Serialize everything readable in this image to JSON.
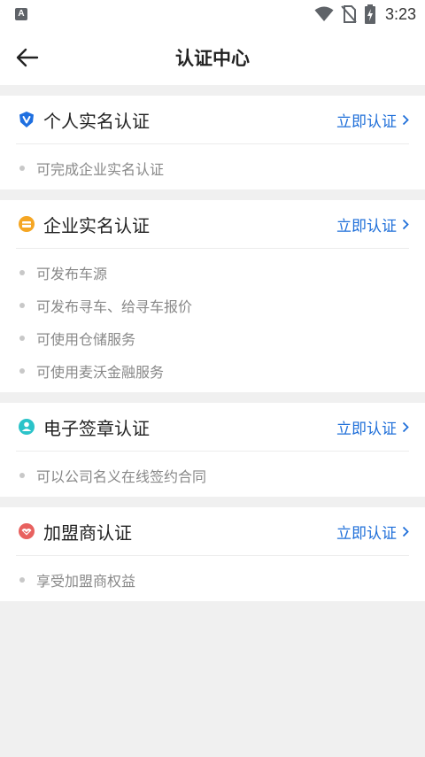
{
  "status_bar": {
    "app_badge": "A",
    "time": "3:23"
  },
  "header": {
    "title": "认证中心"
  },
  "colors": {
    "accent": "#1f6fd9",
    "personal_icon": "#1e6fe0",
    "enterprise_icon": "#f5a623",
    "esign_icon": "#2bc3c9",
    "franchise_icon": "#e8615f"
  },
  "cards": [
    {
      "title": "个人实名认证",
      "action": "立即认证",
      "icon": "shield-v-icon",
      "features": [
        "可完成企业实名认证"
      ]
    },
    {
      "title": "企业实名认证",
      "action": "立即认证",
      "icon": "enterprise-icon",
      "features": [
        "可发布车源",
        "可发布寻车、给寻车报价",
        "可使用仓储服务",
        "可使用麦沃金融服务"
      ]
    },
    {
      "title": "电子签章认证",
      "action": "立即认证",
      "icon": "person-icon",
      "features": [
        "可以公司名义在线签约合同"
      ]
    },
    {
      "title": "加盟商认证",
      "action": "立即认证",
      "icon": "handshake-icon",
      "features": [
        "享受加盟商权益"
      ]
    }
  ]
}
